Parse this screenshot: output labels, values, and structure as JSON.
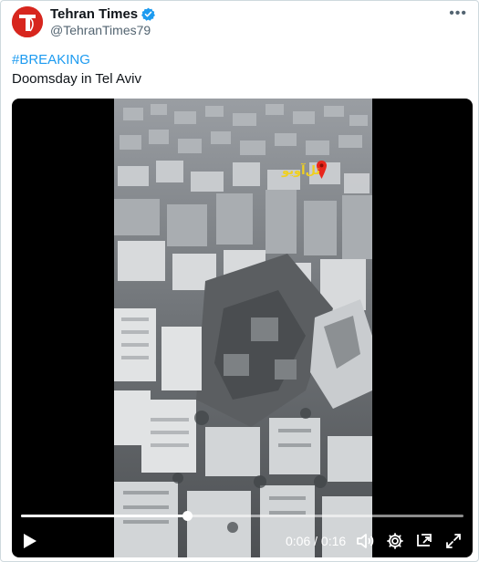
{
  "account": {
    "display_name": "Tehran Times",
    "handle": "@TehranTimes79",
    "avatar_letter": "T",
    "avatar_color": "#d7261e",
    "verified_color": "#1d9bf0"
  },
  "tweet": {
    "hashtag": "#BREAKING",
    "text": "Doomsday in Tel Aviv"
  },
  "video": {
    "overlay_text": "تل‌آویو",
    "time_display": "0:06 / 0:16",
    "progress": 0.375
  },
  "icons": [
    "more-icon",
    "verified-badge-icon",
    "play-icon",
    "volume-icon",
    "settings-gear-icon",
    "pip-icon",
    "fullscreen-icon"
  ]
}
